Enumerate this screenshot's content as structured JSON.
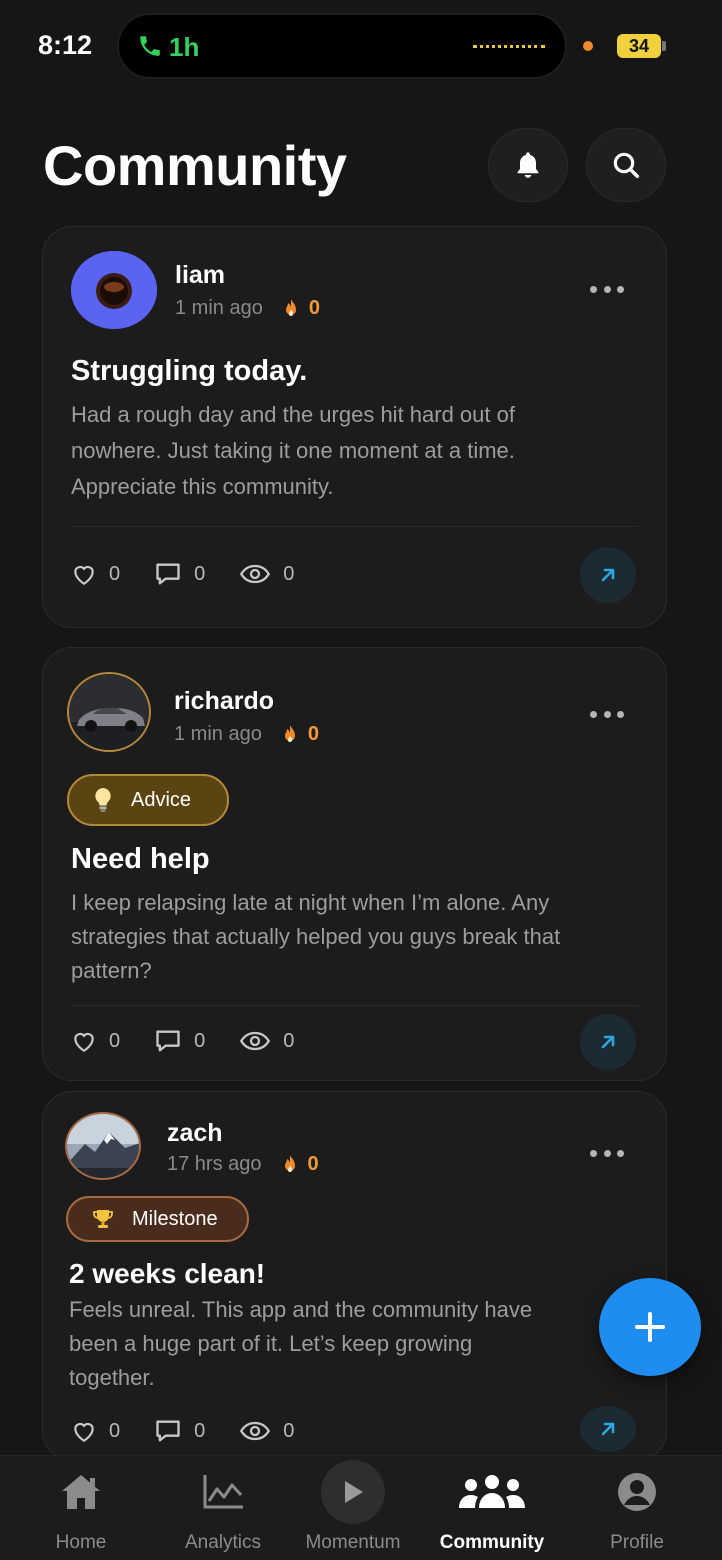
{
  "status_bar": {
    "time": "8:12",
    "call_duration": "1h",
    "battery": "34",
    "colors": {
      "call_green": "#33d35e",
      "battery_yellow": "#f1d03d"
    }
  },
  "header": {
    "title": "Community",
    "bell_icon": "bell-icon",
    "search_icon": "search-icon"
  },
  "posts": [
    {
      "username": "liam",
      "time_ago": "1 min ago",
      "streak": "0",
      "tag": null,
      "title": "Struggling today.",
      "body": "Had a rough day and the urges hit hard out of nowhere. Just taking it one moment at a time. Appreciate this community.",
      "likes": "0",
      "comments": "0",
      "views": "0"
    },
    {
      "username": "richardo",
      "time_ago": "1 min ago",
      "streak": "0",
      "tag": "Advice",
      "title": "Need help",
      "body": "I keep relapsing late at night when I’m alone. Any strategies that actually helped you guys break that pattern?",
      "likes": "0",
      "comments": "0",
      "views": "0"
    },
    {
      "username": "zach",
      "time_ago": "17 hrs ago",
      "streak": "0",
      "tag": "Milestone",
      "title": "2 weeks clean!",
      "body": "Feels unreal. This app and the community have been a huge part of it. Let’s keep growing together.",
      "likes": "0",
      "comments": "0",
      "views": "0"
    }
  ],
  "fab": {
    "icon": "plus-icon",
    "color": "#1e8cf0"
  },
  "nav": {
    "items": [
      {
        "label": "Home",
        "icon": "home-icon"
      },
      {
        "label": "Analytics",
        "icon": "analytics-icon"
      },
      {
        "label": "Momentum",
        "icon": "play-icon"
      },
      {
        "label": "Community",
        "icon": "community-icon",
        "active": true
      },
      {
        "label": "Profile",
        "icon": "profile-icon"
      }
    ]
  },
  "colors": {
    "background": "#161616",
    "card": "#1c1c1c",
    "streak_orange": "#f29a3a",
    "share_accent": "#2fa6e0"
  }
}
